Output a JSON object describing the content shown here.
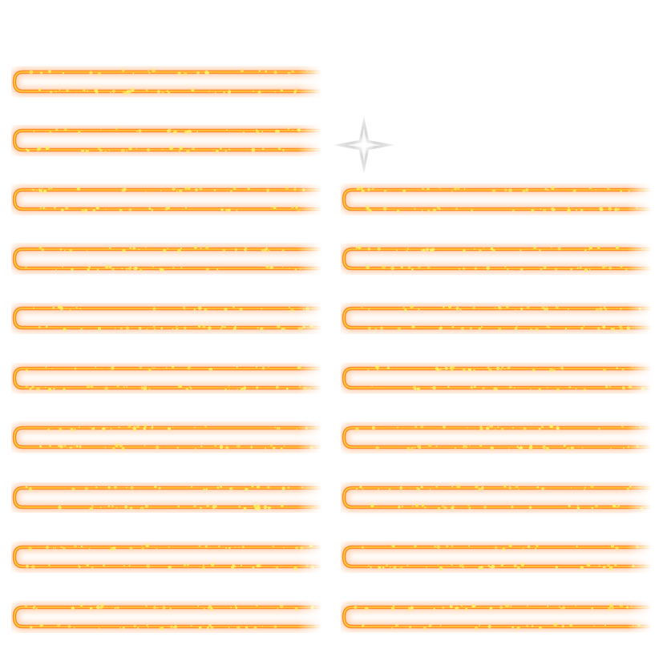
{
  "sprite_sheet": {
    "background": "#ffffff",
    "effect": {
      "name": "fire-loop-stroke",
      "glow_color": "#ffb07a",
      "stroke_color": "#ff8a2a",
      "core_color": "#ffd23a",
      "spark_color": "#fff06a"
    },
    "left_column_count": 10,
    "right_column_count": 8,
    "sparkle": {
      "icon": "four-point-star-icon",
      "color": "#a8a8a8"
    }
  }
}
